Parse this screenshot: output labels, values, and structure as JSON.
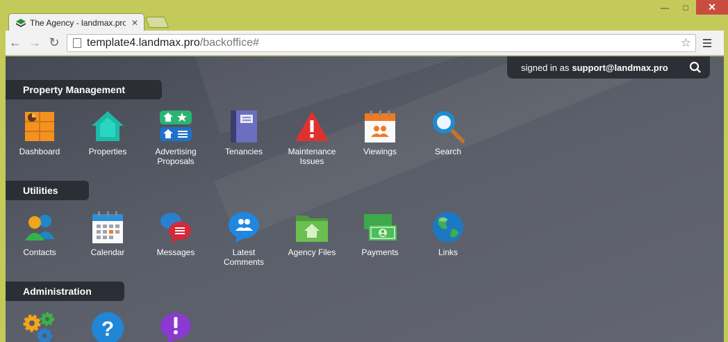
{
  "browser": {
    "tab_title": "The Agency - landmax.pro",
    "url_host": "template4.landmax.pro",
    "url_path": "/backoffice#",
    "window_buttons": {
      "minimize": "—",
      "maximize": "□",
      "close": "✕"
    }
  },
  "header": {
    "signed_in_prefix": "signed in as",
    "user_email": "support@landmax.pro"
  },
  "sections": {
    "property_management": {
      "title": "Property Management",
      "items": [
        {
          "label": "Dashboard",
          "icon": "dashboard-icon"
        },
        {
          "label": "Properties",
          "icon": "house-icon"
        },
        {
          "label": "Advertising Proposals",
          "icon": "advertising-icon"
        },
        {
          "label": "Tenancies",
          "icon": "book-icon"
        },
        {
          "label": "Maintenance Issues",
          "icon": "warning-icon"
        },
        {
          "label": "Viewings",
          "icon": "calendar-people-icon"
        },
        {
          "label": "Search",
          "icon": "magnifier-icon"
        }
      ]
    },
    "utilities": {
      "title": "Utilities",
      "items": [
        {
          "label": "Contacts",
          "icon": "contacts-icon"
        },
        {
          "label": "Calendar",
          "icon": "calendar-icon"
        },
        {
          "label": "Messages",
          "icon": "chat-bubbles-icon"
        },
        {
          "label": "Latest Comments",
          "icon": "comment-icon"
        },
        {
          "label": "Agency Files",
          "icon": "folder-icon"
        },
        {
          "label": "Payments",
          "icon": "money-icon"
        },
        {
          "label": "Links",
          "icon": "globe-icon"
        }
      ]
    },
    "administration": {
      "title": "Administration",
      "items": [
        {
          "label": "",
          "icon": "gears-icon"
        },
        {
          "label": "",
          "icon": "help-icon"
        },
        {
          "label": "",
          "icon": "alert-bubble-icon"
        }
      ]
    }
  },
  "colors": {
    "frame": "#c3ca5a",
    "section_bg": "#2b2e35",
    "page_bg": "#585c66"
  }
}
